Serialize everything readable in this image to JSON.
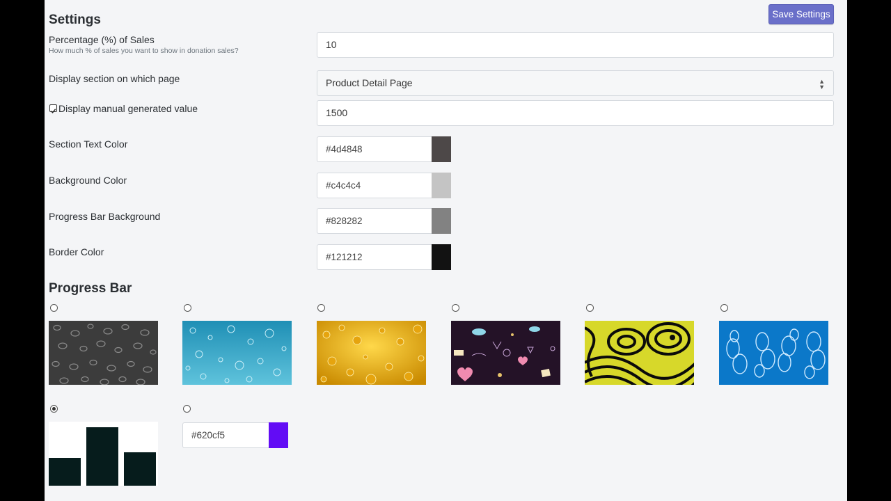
{
  "settings": {
    "title": "Settings",
    "save_label": "Save Settings",
    "percentage": {
      "label": "Percentage (%) of Sales",
      "help": "How much % of sales you want to show in donation sales?",
      "value": "10"
    },
    "display_page": {
      "label": "Display section on which page",
      "value": "Product Detail Page"
    },
    "manual_value": {
      "label": "Display manual generated value",
      "checked": true,
      "value": "1500"
    },
    "colors": [
      {
        "label": "Section Text Color",
        "value": "#4d4848"
      },
      {
        "label": "Background Color",
        "value": "#c4c4c4"
      },
      {
        "label": "Progress Bar Background",
        "value": "#828282"
      },
      {
        "label": "Border Color",
        "value": "#121212"
      }
    ]
  },
  "progress_bar": {
    "title": "Progress Bar",
    "options": [
      {
        "name": "dark-bubbles-pattern",
        "selected": false
      },
      {
        "name": "blue-water-bubbles-pattern",
        "selected": false
      },
      {
        "name": "golden-bubbles-pattern",
        "selected": false
      },
      {
        "name": "doodle-hearts-pattern",
        "selected": false
      },
      {
        "name": "yellow-psychedelic-pattern",
        "selected": false
      },
      {
        "name": "blue-rings-pattern",
        "selected": false
      },
      {
        "name": "bar-graph-pattern",
        "selected": true
      },
      {
        "name": "custom-color",
        "selected": false,
        "value": "#620cf5"
      }
    ]
  }
}
